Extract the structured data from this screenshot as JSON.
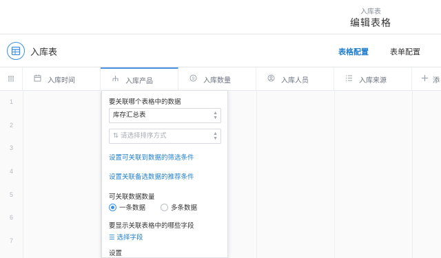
{
  "header": {
    "subtitle": "入库表",
    "title": "编辑表格"
  },
  "form_bar": {
    "icon": "table-icon",
    "name": "入库表",
    "tabs": [
      {
        "label": "表格配置",
        "active": true
      },
      {
        "label": "表单配置",
        "active": false
      }
    ]
  },
  "grid": {
    "columns": [
      {
        "icon": "calendar-icon",
        "label": "入库时间"
      },
      {
        "icon": "relation-icon",
        "label": "入库产品"
      },
      {
        "icon": "number-icon",
        "label": "入库数量"
      },
      {
        "icon": "person-icon",
        "label": "入库人员"
      },
      {
        "icon": "list-icon",
        "label": "入库来源"
      },
      {
        "icon": "plus-icon",
        "label": "添"
      }
    ],
    "rows": [
      "1",
      "2",
      "3",
      "4",
      "5",
      "6",
      "7"
    ]
  },
  "panel": {
    "related_table_label": "要关联哪个表格中的数据",
    "related_table_value": "库存汇总表",
    "sort_placeholder": "请选择排序方式",
    "filter_link": "设置可关联到数据的筛选条件",
    "recommend_link": "设置关联备选数据的推荐条件",
    "count_label": "可关联数据数量",
    "options": [
      "一条数据",
      "多条数据"
    ],
    "fields_label": "要显示关联表格中的哪些字段",
    "select_fields_link": "选择字段",
    "settings_label": "设置"
  }
}
